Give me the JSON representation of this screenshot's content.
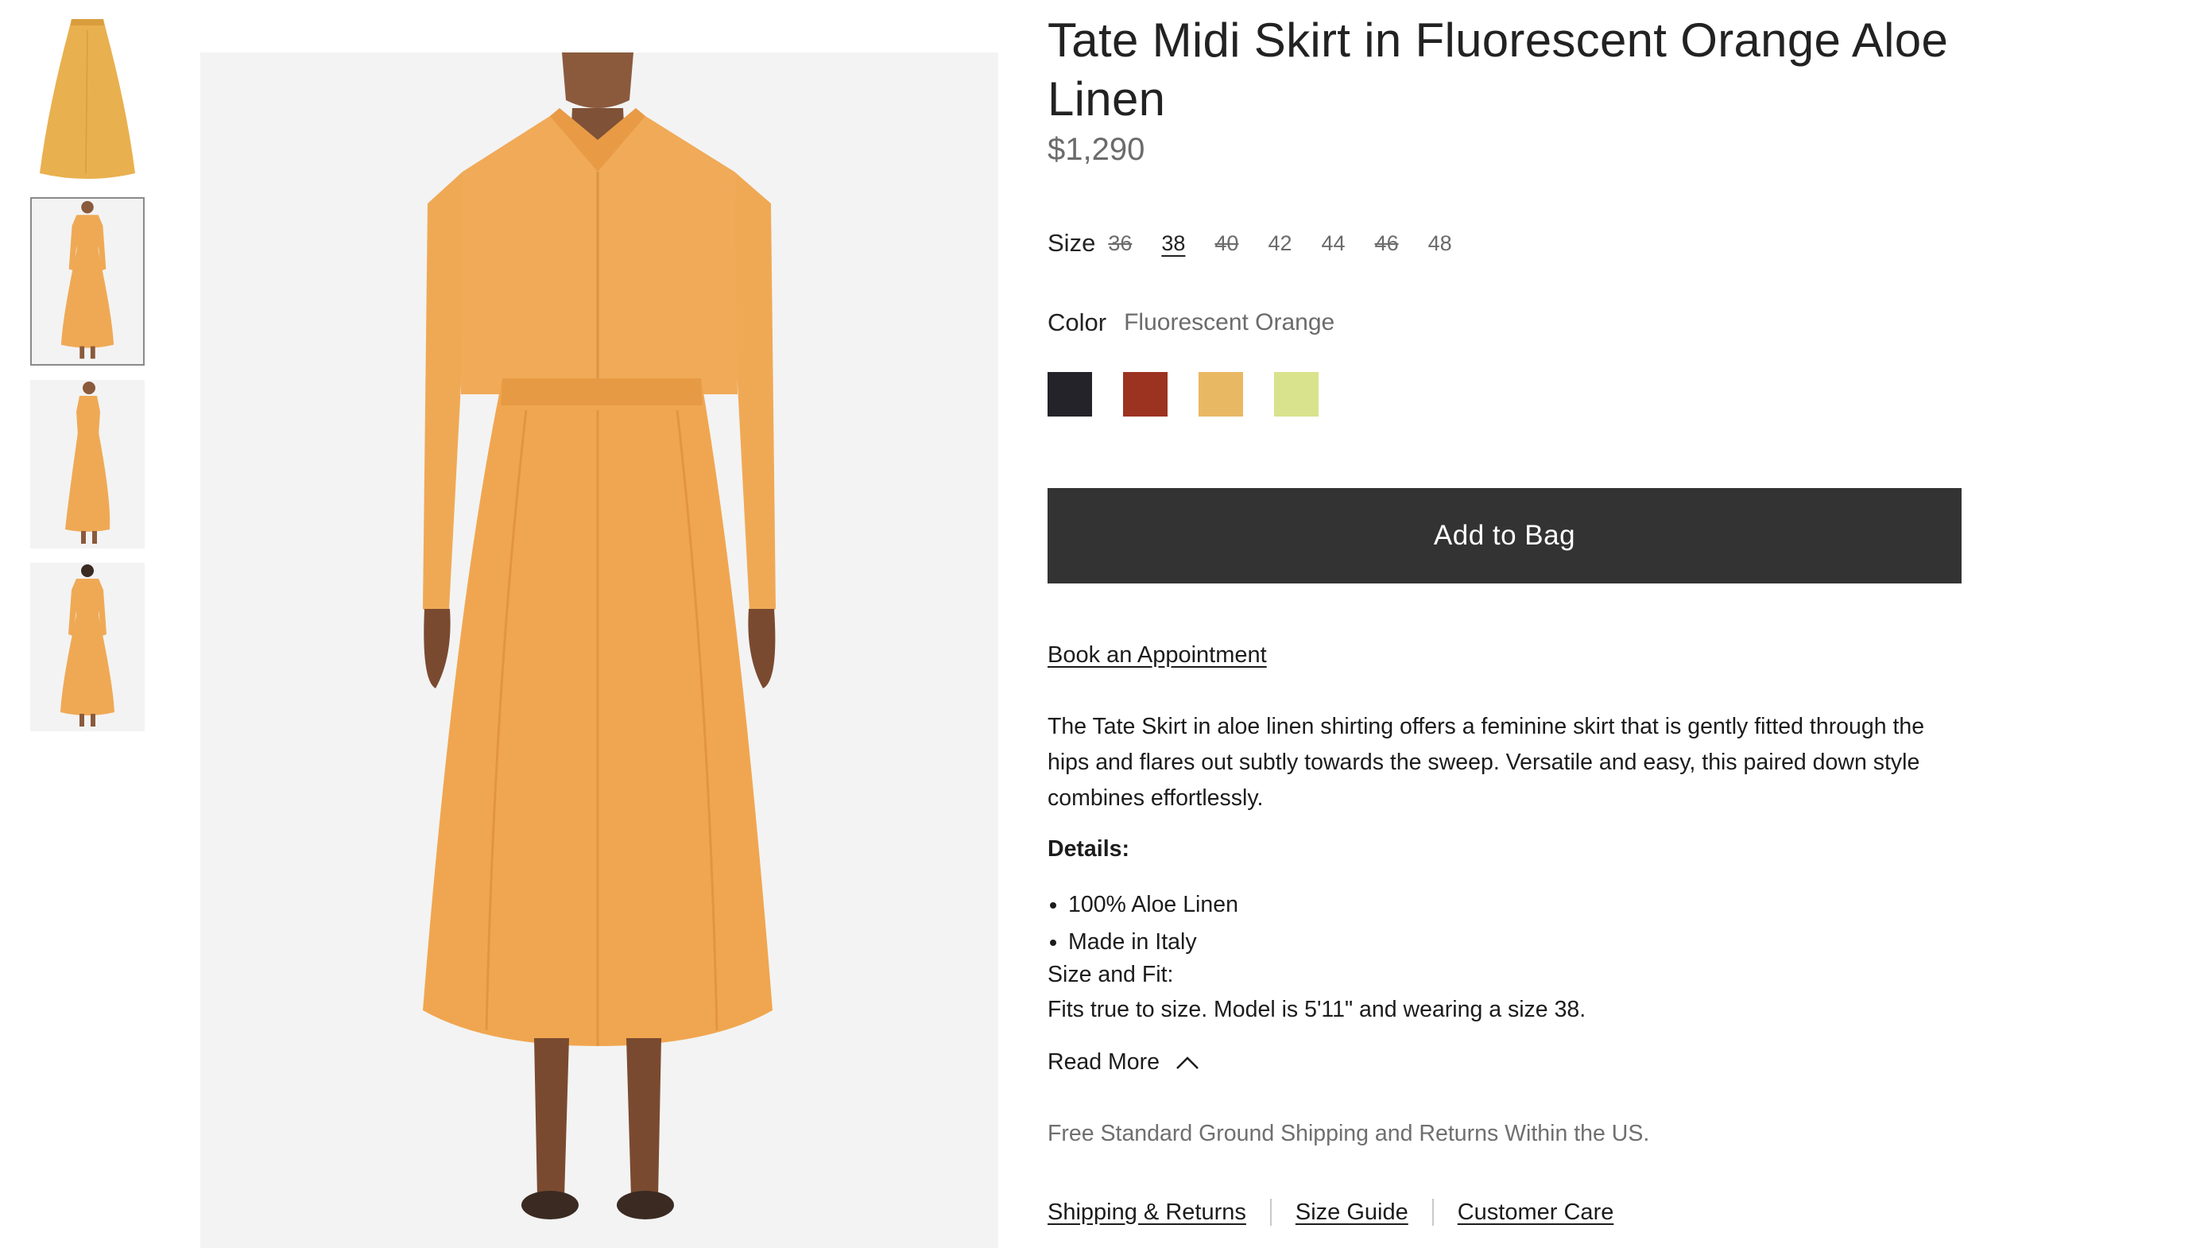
{
  "product": {
    "title": "Tate Midi Skirt in Fluorescent Orange Aloe Linen",
    "price": "$1,290"
  },
  "gallery": {
    "thumbnails": [
      "skirt-flat",
      "model-front",
      "model-side",
      "model-back"
    ],
    "selected_index": 1,
    "main_image": "model-front"
  },
  "size": {
    "label": "Size",
    "options": [
      {
        "label": "36",
        "available": false
      },
      {
        "label": "38",
        "available": true,
        "selected": true
      },
      {
        "label": "40",
        "available": false
      },
      {
        "label": "42",
        "available": true
      },
      {
        "label": "44",
        "available": true
      },
      {
        "label": "46",
        "available": false
      },
      {
        "label": "48",
        "available": true
      }
    ]
  },
  "color": {
    "label": "Color",
    "value": "Fluorescent Orange",
    "swatches": [
      "#24232a",
      "#9c3321",
      "#e9b863",
      "#d9e28c"
    ]
  },
  "actions": {
    "add_to_bag": "Add to Bag",
    "book_appointment": "Book an Appointment"
  },
  "description": "The Tate Skirt in aloe linen shirting offers a feminine skirt that is gently fitted through the hips and flares out subtly towards the sweep. Versatile and easy, this paired down style combines effortlessly.",
  "details": {
    "heading": "Details:",
    "items": [
      "100% Aloe Linen",
      "Made in Italy"
    ],
    "fit_heading": "Size and Fit:",
    "fit_text": "Fits true to size. Model is 5'11\" and wearing a size 38."
  },
  "read_more": "Read More",
  "shipping_note": "Free Standard Ground Shipping and Returns Within the US.",
  "footer_links": {
    "shipping": "Shipping & Returns",
    "size_guide": "Size Guide",
    "customer_care": "Customer Care"
  },
  "colors": {
    "garment": "#efa955",
    "button": "#333333",
    "image_bg": "#f3f3f3"
  }
}
